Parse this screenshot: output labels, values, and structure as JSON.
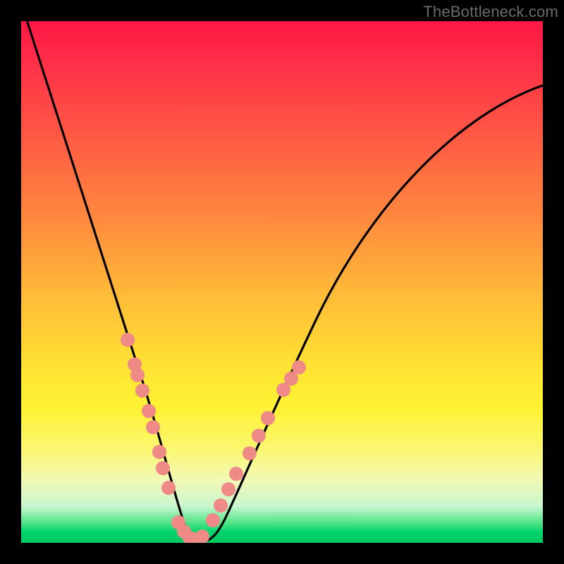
{
  "watermark": {
    "text": "TheBottleneck.com"
  },
  "chart_data": {
    "type": "line",
    "title": "",
    "xlabel": "",
    "ylabel": "",
    "xlim": [
      0,
      100
    ],
    "ylim": [
      0,
      100
    ],
    "series": [
      {
        "name": "bottleneck-curve",
        "x": [
          0,
          4,
          8,
          12,
          16,
          19,
          22,
          24,
          26,
          27.5,
          29,
          30.5,
          32,
          34,
          36,
          39,
          43,
          48,
          54,
          60,
          68,
          76,
          84,
          92,
          100
        ],
        "y": [
          100,
          88,
          76,
          64,
          52,
          42,
          33,
          26,
          18,
          12,
          6,
          2,
          0,
          0,
          3,
          8,
          15,
          24,
          34,
          44,
          55,
          64,
          72,
          78,
          83
        ]
      }
    ],
    "markers": {
      "name": "highlight-dots",
      "color": "#f08080",
      "points": [
        {
          "x": 20.0,
          "y": 39
        },
        {
          "x": 21.5,
          "y": 34
        },
        {
          "x": 22.0,
          "y": 32
        },
        {
          "x": 23.0,
          "y": 29
        },
        {
          "x": 24.2,
          "y": 25
        },
        {
          "x": 25.0,
          "y": 22
        },
        {
          "x": 26.3,
          "y": 17
        },
        {
          "x": 27.0,
          "y": 14
        },
        {
          "x": 28.0,
          "y": 10
        },
        {
          "x": 30.0,
          "y": 3.5
        },
        {
          "x": 31.0,
          "y": 1.8
        },
        {
          "x": 32.0,
          "y": 0.5
        },
        {
          "x": 33.0,
          "y": 0.3
        },
        {
          "x": 34.5,
          "y": 0.9
        },
        {
          "x": 36.5,
          "y": 4
        },
        {
          "x": 38.0,
          "y": 7
        },
        {
          "x": 39.5,
          "y": 10
        },
        {
          "x": 41.0,
          "y": 13
        },
        {
          "x": 43.5,
          "y": 17
        },
        {
          "x": 45.5,
          "y": 21
        },
        {
          "x": 47.0,
          "y": 24
        },
        {
          "x": 50.0,
          "y": 29
        },
        {
          "x": 51.5,
          "y": 31
        },
        {
          "x": 53.0,
          "y": 33
        }
      ]
    },
    "gradient_stops": [
      {
        "pos": 0,
        "color": "#ff1745"
      },
      {
        "pos": 50,
        "color": "#ffd338"
      },
      {
        "pos": 100,
        "color": "#00c862"
      }
    ]
  }
}
